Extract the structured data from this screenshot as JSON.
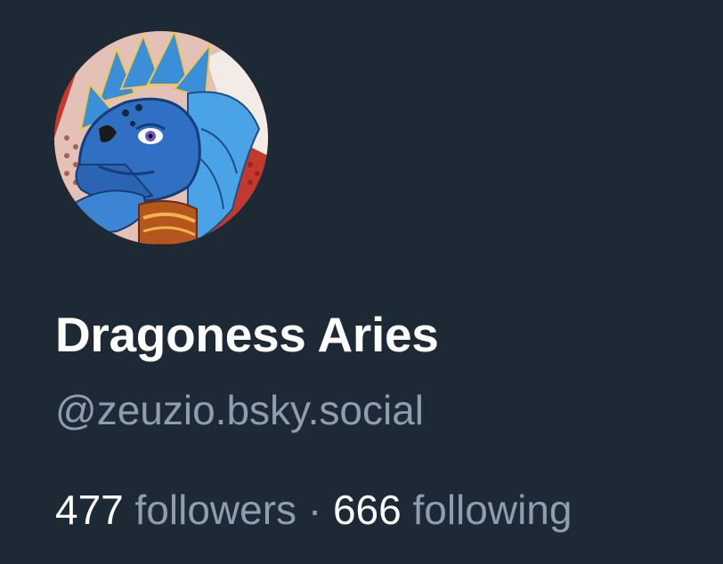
{
  "profile": {
    "display_name": "Dragoness Aries",
    "handle": "@zeuzio.bsky.social",
    "avatar_icon": "dragon-avatar"
  },
  "stats": {
    "followers_count": "477",
    "followers_label": "followers",
    "separator": "·",
    "following_count": "666",
    "following_label": "following"
  },
  "colors": {
    "background": "#1e2936",
    "name_text": "#ffffff",
    "secondary_text": "#8f9db0"
  }
}
